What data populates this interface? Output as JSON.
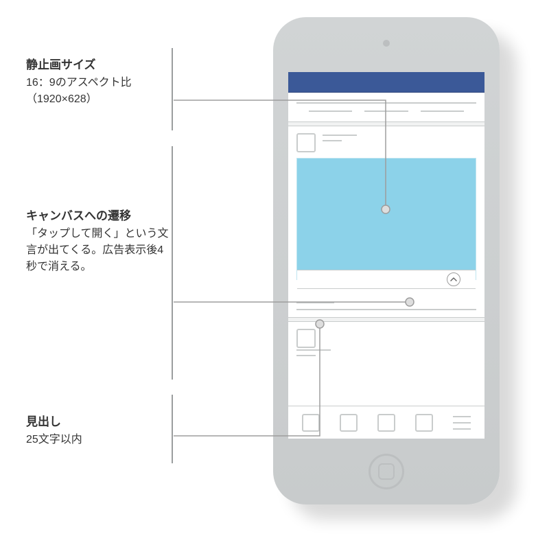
{
  "annotations": {
    "a1": {
      "title": "静止画サイズ",
      "body1": "16：9のアスペクト比",
      "body2": "（1920×628）"
    },
    "a2": {
      "title": "キャンバスへの遷移",
      "body": "「タップして開く」という文言が出てくる。広告表示後4秒で消える。"
    },
    "a3": {
      "title": "見出し",
      "body": "25文字以内"
    }
  },
  "spec": {
    "still_image_aspect": "16:9",
    "still_image_dimensions": "1920×628",
    "headline_max_chars": 25,
    "canvas_prompt_text": "タップして開く",
    "canvas_prompt_hide_after_seconds": 4
  },
  "phone": {
    "topbar_color": "#3b5998",
    "hero_color": "#8cd2e9",
    "nav_items": [
      "square",
      "square",
      "square",
      "square",
      "menu"
    ]
  },
  "icons": {
    "chevron_up": "chevron-up-icon",
    "home": "home-button-icon",
    "menu": "hamburger-menu-icon"
  }
}
